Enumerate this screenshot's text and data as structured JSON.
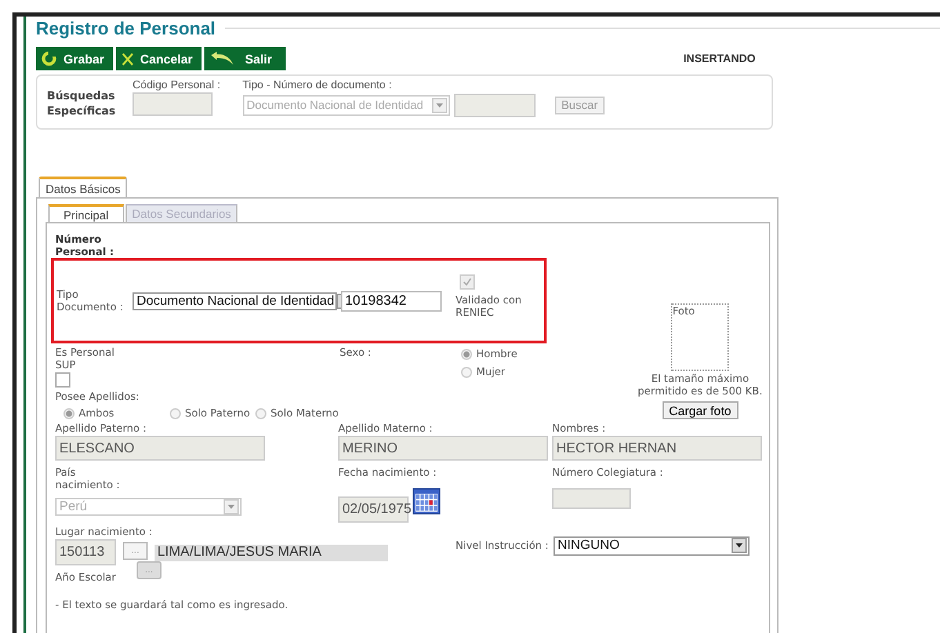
{
  "title": "Registro de Personal",
  "toolbar": [
    {
      "label": "Grabar"
    },
    {
      "label": "Cancelar"
    },
    {
      "label": "Salir"
    }
  ],
  "mode": "INSERTANDO",
  "search": {
    "label": "Búsquedas Específicas",
    "code_label": "Código Personal :",
    "doc_label": "Tipo - Número de documento :",
    "doc_type": "Documento Nacional de Identidad",
    "button": "Buscar"
  },
  "outer_tabs": [
    {
      "label": "Datos Básicos",
      "selected": true
    }
  ],
  "inner_tabs": [
    {
      "label": "Principal",
      "selected": true
    },
    {
      "label": "Datos Secundarios",
      "selected": false
    }
  ],
  "form": {
    "numero_personal_label": "Número Personal :",
    "tipo_documento": {
      "label": "Tipo Documento :",
      "value": "Documento Nacional de Identidad",
      "number": "10198342",
      "highlighted": true
    },
    "validado": {
      "label": "Validado con RENIEC",
      "checked": true
    },
    "foto": {
      "label": "Foto",
      "note": "El tamaño máximo permitido es de 500 KB.",
      "button": "Cargar foto"
    },
    "es_personal_sup": {
      "label": "Es Personal SUP",
      "checked": false
    },
    "sexo": {
      "label": "Sexo :",
      "options": [
        {
          "label": "Hombre",
          "selected": true
        },
        {
          "label": "Mujer",
          "selected": false
        }
      ]
    },
    "apellidos": {
      "label": "Posee Apellidos:",
      "options": [
        {
          "label": "Ambos",
          "selected": true
        },
        {
          "label": "Solo Paterno",
          "selected": false
        },
        {
          "label": "Solo Materno",
          "selected": false
        }
      ]
    },
    "names": [
      {
        "label": "Apellido Paterno :",
        "value": "ELESCANO"
      },
      {
        "label": "Apellido Materno :",
        "value": "MERINO"
      },
      {
        "label": "Nombres :",
        "value": "HECTOR HERNAN"
      }
    ],
    "pais": {
      "label": "País nacimiento :",
      "value": "Perú",
      "disabled": true
    },
    "fecha": {
      "label": "Fecha nacimiento :",
      "value": "02/05/1975"
    },
    "colegiatura": {
      "label": "Número Colegiatura :"
    },
    "lugar": {
      "label": "Lugar nacimiento :",
      "code": "150113",
      "button": "...",
      "value": "LIMA/LIMA/JESUS MARIA"
    },
    "nivel": {
      "label": "Nivel Instrucción :",
      "value": "NINGUNO"
    },
    "anio": {
      "label": "Año Escolar",
      "button": "..."
    },
    "note": "- El texto se guardará tal como es ingresado."
  }
}
